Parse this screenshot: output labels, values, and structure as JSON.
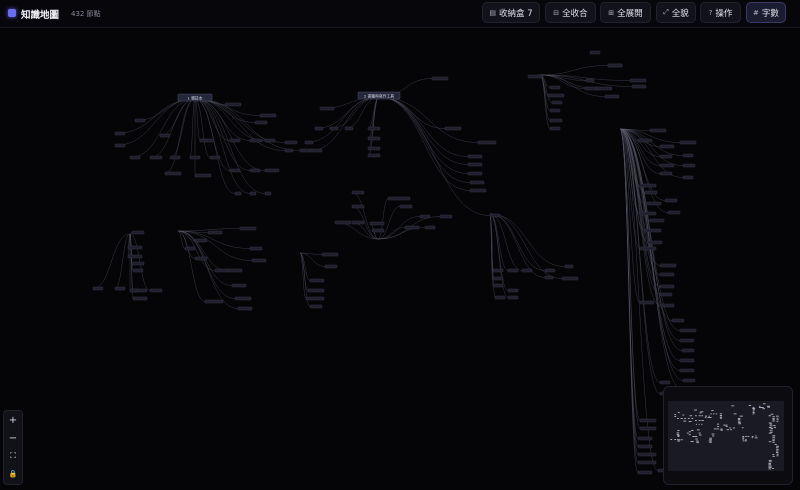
{
  "header": {
    "app_title": "知識地圖",
    "node_count": "432 節點"
  },
  "toolbar": {
    "inbox_icon": "▤",
    "inbox_label": "收納盒 7",
    "collapse_icon": "⊟",
    "collapse_label": "全收合",
    "expand_icon": "⊞",
    "expand_label": "全展開",
    "fit_icon": "⤢",
    "fit_label": "全貌",
    "help_icon": "?",
    "help_label": "操作",
    "wordcount_icon": "#",
    "wordcount_label": "字數"
  },
  "graph": {
    "roots": [
      "1 雜誌本",
      "2 書籍與寫作工具"
    ]
  },
  "zoom": {
    "zoom_in": "+",
    "zoom_out": "−",
    "fit": "⛶",
    "lock": "🔒"
  },
  "colors": {
    "background": "#050508",
    "node": "#1e1e2c",
    "node_border": "#3c3c52",
    "edge": "#5a5a6e",
    "accent": "#6b6cf0"
  }
}
